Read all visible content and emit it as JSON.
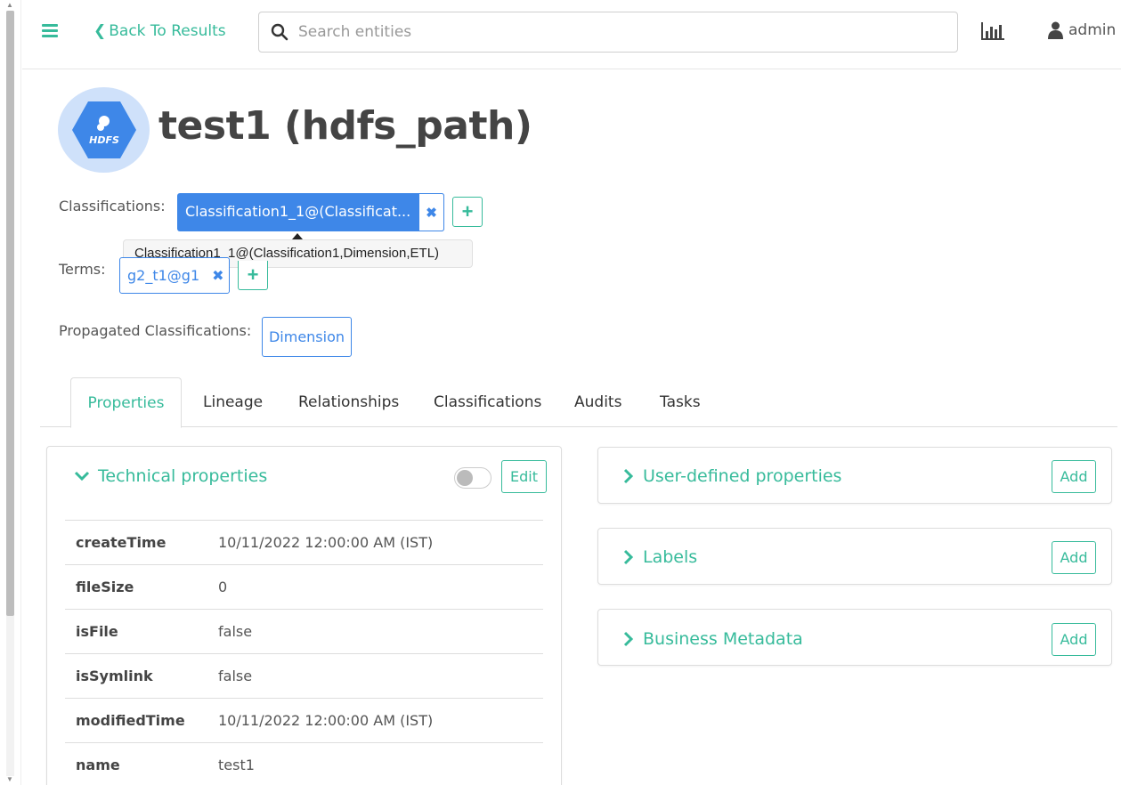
{
  "header": {
    "back_label": "Back To Results",
    "search_placeholder": "Search entities",
    "user": "admin"
  },
  "entity": {
    "title": "test1 (hdfs_path)",
    "logo_text": "HDFS"
  },
  "classifications": {
    "label": "Classifications:",
    "tag": "Classification1_1@(Classificat...",
    "tooltip": "Classification1_1@(Classification1,Dimension,ETL)"
  },
  "terms": {
    "label": "Terms:",
    "tag": "g2_t1@g1"
  },
  "propagated": {
    "label": "Propagated Classifications:",
    "tag": "Dimension"
  },
  "tabs": [
    "Properties",
    "Lineage",
    "Relationships",
    "Classifications",
    "Audits",
    "Tasks"
  ],
  "technical": {
    "title": "Technical properties",
    "edit_label": "Edit",
    "rows": [
      {
        "key": "createTime",
        "value": "10/11/2022 12:00:00 AM (IST)"
      },
      {
        "key": "fileSize",
        "value": "0"
      },
      {
        "key": "isFile",
        "value": "false"
      },
      {
        "key": "isSymlink",
        "value": "false"
      },
      {
        "key": "modifiedTime",
        "value": "10/11/2022 12:00:00 AM (IST)"
      },
      {
        "key": "name",
        "value": "test1"
      }
    ]
  },
  "side_panels": [
    {
      "title": "User-defined properties",
      "action": "Add"
    },
    {
      "title": "Labels",
      "action": "Add"
    },
    {
      "title": "Business Metadata",
      "action": "Add"
    }
  ],
  "colors": {
    "accent": "#37bb9b",
    "tag_blue": "#3e87e8"
  }
}
